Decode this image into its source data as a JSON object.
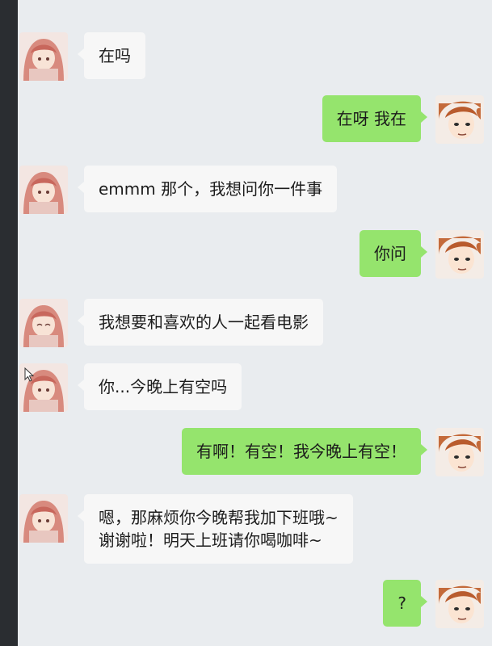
{
  "chat": {
    "title": "",
    "messages": [
      {
        "side": "left",
        "lines": [
          "在吗"
        ]
      },
      {
        "side": "right",
        "lines": [
          "在呀 我在"
        ]
      },
      {
        "side": "left",
        "lines": [
          "emmm 那个，我想问你一件事"
        ]
      },
      {
        "side": "right",
        "lines": [
          "你问"
        ]
      },
      {
        "side": "left",
        "lines": [
          "我想要和喜欢的人一起看电影"
        ]
      },
      {
        "side": "left",
        "lines": [
          "你...今晚上有空吗"
        ]
      },
      {
        "side": "right",
        "lines": [
          "有啊！有空！我今晚上有空！"
        ]
      },
      {
        "side": "left",
        "lines": [
          "嗯，那麻烦你今晚帮我加下班哦~",
          "谢谢啦！明天上班请你喝咖啡~"
        ]
      },
      {
        "side": "right",
        "lines": [
          "?"
        ]
      }
    ]
  },
  "colors": {
    "self_bubble": "#95e46d",
    "other_bubble": "#f7f7f7",
    "background": "#e9ecef"
  },
  "icons": {
    "other_avatar": "anime-girl-avatar",
    "self_avatar": "anime-boy-avatar",
    "cursor": "mouse-cursor-icon"
  }
}
